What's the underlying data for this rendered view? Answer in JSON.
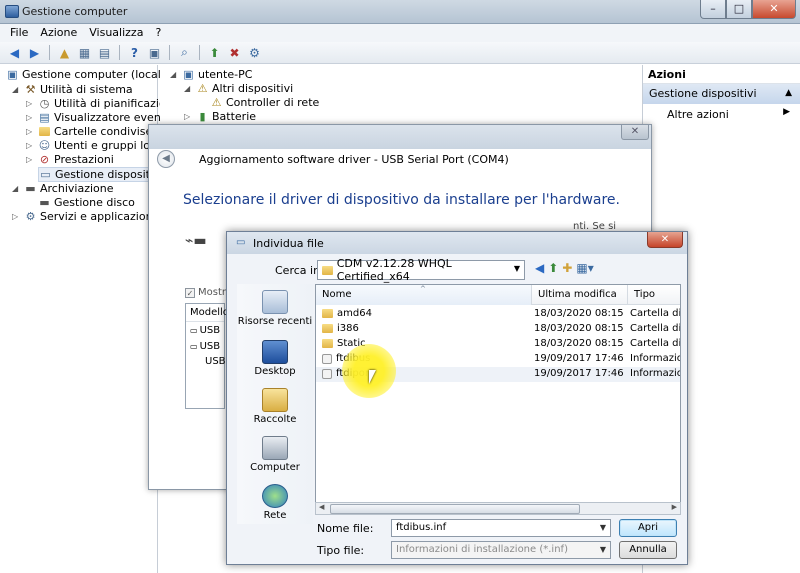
{
  "main_window": {
    "title": "Gestione computer",
    "controls": {
      "minimize": "–",
      "maximize": "□",
      "close": "✕"
    },
    "menu": [
      "File",
      "Azione",
      "Visualizza",
      "?"
    ]
  },
  "tree": [
    {
      "label": "Gestione computer (locale)",
      "icon": "computer-mgmt-icon"
    },
    {
      "label": "Utilità di sistema",
      "icon": "tools-icon"
    },
    {
      "label": "Utilità di pianificazione",
      "icon": "clock-icon"
    },
    {
      "label": "Visualizzatore eventi",
      "icon": "event-viewer-icon"
    },
    {
      "label": "Cartelle condivise",
      "icon": "shared-folder-icon"
    },
    {
      "label": "Utenti e gruppi locali",
      "icon": "users-icon"
    },
    {
      "label": "Prestazioni",
      "icon": "performance-icon"
    },
    {
      "label": "Gestione dispositivi",
      "icon": "device-manager-icon"
    },
    {
      "label": "Archiviazione",
      "icon": "storage-icon"
    },
    {
      "label": "Gestione disco",
      "icon": "disk-icon"
    },
    {
      "label": "Servizi e applicazioni",
      "icon": "services-icon"
    }
  ],
  "device_tree": {
    "root": "utente-PC",
    "items": [
      "Altri dispositivi",
      "Controller di rete",
      "Batterie"
    ]
  },
  "actions": {
    "header": "Azioni",
    "selected": "Gestione dispositivi",
    "items": [
      "Altre azioni"
    ]
  },
  "wizard": {
    "title": "Aggiornamento software driver - USB Serial Port (COM4)",
    "heading": "Selezionare il driver di dispositivo da installare per l'hardware.",
    "side_text": "nti. Se si",
    "checkbox_label": "Mostr",
    "list_header": "Modello",
    "list_rows": [
      "USB",
      "USB",
      "USB"
    ]
  },
  "file_dialog": {
    "title": "Individua file",
    "look_in_label": "Cerca in:",
    "look_in_value": "CDM v2.12.28 WHQL Certified_x64",
    "places": [
      "Risorse recenti",
      "Desktop",
      "Raccolte",
      "Computer",
      "Rete"
    ],
    "columns": {
      "name": "Nome",
      "date": "Ultima modifica",
      "type": "Tipo"
    },
    "files": [
      {
        "name": "amd64",
        "date": "18/03/2020 08:15",
        "type": "Cartella di",
        "kind": "folder"
      },
      {
        "name": "i386",
        "date": "18/03/2020 08:15",
        "type": "Cartella di",
        "kind": "folder"
      },
      {
        "name": "Static",
        "date": "18/03/2020 08:15",
        "type": "Cartella di",
        "kind": "folder"
      },
      {
        "name": "ftdibus",
        "date": "19/09/2017 17:46",
        "type": "Informazio",
        "kind": "file"
      },
      {
        "name": "ftdiport",
        "date": "19/09/2017 17:46",
        "type": "Informazio",
        "kind": "file"
      }
    ],
    "filename_label": "Nome file:",
    "filename_value": "ftdibus.inf",
    "filetype_label": "Tipo file:",
    "filetype_value": "Informazioni di installazione (*.inf)",
    "open_button": "Apri",
    "cancel_button": "Annulla"
  },
  "colors": {
    "accent": "#1b3f8f",
    "selection": "#c5d6ec",
    "highlight": "#fff028"
  }
}
